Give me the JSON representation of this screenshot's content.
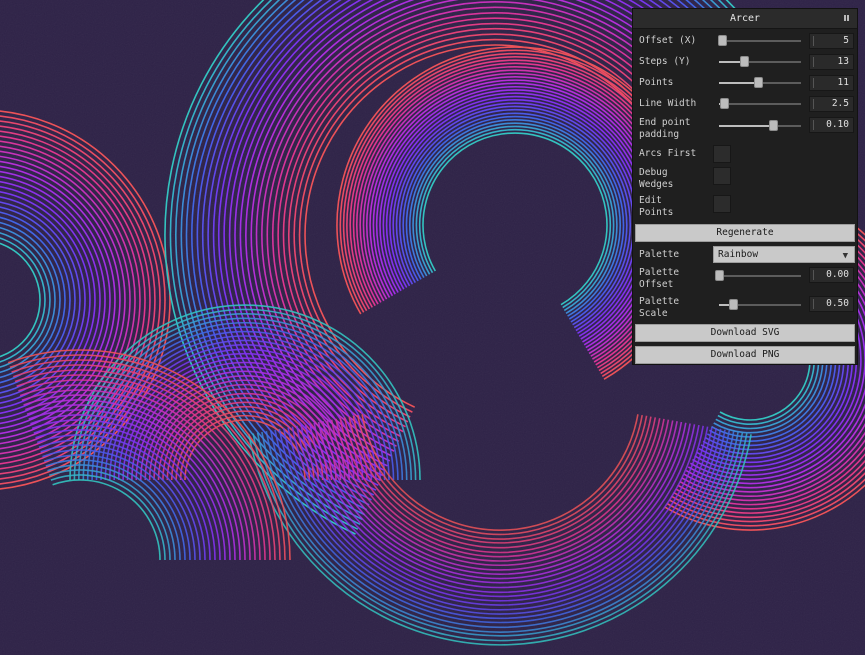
{
  "panel": {
    "title": "Arcer",
    "controls": [
      {
        "label": "Offset (X)",
        "value": "5",
        "fraction": 0.04
      },
      {
        "label": "Steps (Y)",
        "value": "13",
        "fraction": 0.3
      },
      {
        "label": "Points",
        "value": "11",
        "fraction": 0.47
      },
      {
        "label": "Line Width",
        "value": "2.5",
        "fraction": 0.06
      },
      {
        "label": "End point\npadding",
        "value": "0.10",
        "fraction": 0.66
      }
    ],
    "checkboxes": [
      {
        "label": "Arcs First",
        "checked": false
      },
      {
        "label": "Debug\nWedges",
        "checked": false
      },
      {
        "label": "Edit\nPoints",
        "checked": false
      }
    ],
    "regenerate_label": "Regenerate",
    "palette": {
      "label": "Palette",
      "selected": "Rainbow"
    },
    "palette_controls": [
      {
        "label": "Palette\nOffset",
        "value": "0.00",
        "fraction": 0.0
      },
      {
        "label": "Palette\nScale",
        "value": "0.50",
        "fraction": 0.17
      }
    ],
    "download_svg_label": "Download SVG",
    "download_png_label": "Download PNG"
  },
  "artwork": {
    "background_color": "#2e2247",
    "palette_colors": [
      "#ee4f55",
      "#e0318f",
      "#b22ae0",
      "#7b2ef2",
      "#3f5fe8",
      "#2fc4c0"
    ]
  }
}
